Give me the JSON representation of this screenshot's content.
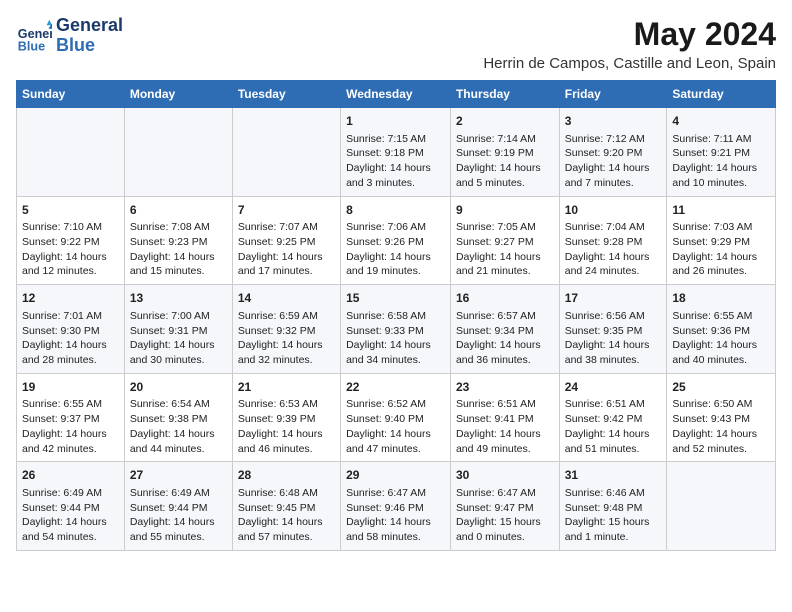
{
  "header": {
    "logo_line1": "General",
    "logo_line2": "Blue",
    "month": "May 2024",
    "location": "Herrin de Campos, Castille and Leon, Spain"
  },
  "weekdays": [
    "Sunday",
    "Monday",
    "Tuesday",
    "Wednesday",
    "Thursday",
    "Friday",
    "Saturday"
  ],
  "weeks": [
    [
      {
        "day": "",
        "content": ""
      },
      {
        "day": "",
        "content": ""
      },
      {
        "day": "",
        "content": ""
      },
      {
        "day": "1",
        "content": "Sunrise: 7:15 AM\nSunset: 9:18 PM\nDaylight: 14 hours and 3 minutes."
      },
      {
        "day": "2",
        "content": "Sunrise: 7:14 AM\nSunset: 9:19 PM\nDaylight: 14 hours and 5 minutes."
      },
      {
        "day": "3",
        "content": "Sunrise: 7:12 AM\nSunset: 9:20 PM\nDaylight: 14 hours and 7 minutes."
      },
      {
        "day": "4",
        "content": "Sunrise: 7:11 AM\nSunset: 9:21 PM\nDaylight: 14 hours and 10 minutes."
      }
    ],
    [
      {
        "day": "5",
        "content": "Sunrise: 7:10 AM\nSunset: 9:22 PM\nDaylight: 14 hours and 12 minutes."
      },
      {
        "day": "6",
        "content": "Sunrise: 7:08 AM\nSunset: 9:23 PM\nDaylight: 14 hours and 15 minutes."
      },
      {
        "day": "7",
        "content": "Sunrise: 7:07 AM\nSunset: 9:25 PM\nDaylight: 14 hours and 17 minutes."
      },
      {
        "day": "8",
        "content": "Sunrise: 7:06 AM\nSunset: 9:26 PM\nDaylight: 14 hours and 19 minutes."
      },
      {
        "day": "9",
        "content": "Sunrise: 7:05 AM\nSunset: 9:27 PM\nDaylight: 14 hours and 21 minutes."
      },
      {
        "day": "10",
        "content": "Sunrise: 7:04 AM\nSunset: 9:28 PM\nDaylight: 14 hours and 24 minutes."
      },
      {
        "day": "11",
        "content": "Sunrise: 7:03 AM\nSunset: 9:29 PM\nDaylight: 14 hours and 26 minutes."
      }
    ],
    [
      {
        "day": "12",
        "content": "Sunrise: 7:01 AM\nSunset: 9:30 PM\nDaylight: 14 hours and 28 minutes."
      },
      {
        "day": "13",
        "content": "Sunrise: 7:00 AM\nSunset: 9:31 PM\nDaylight: 14 hours and 30 minutes."
      },
      {
        "day": "14",
        "content": "Sunrise: 6:59 AM\nSunset: 9:32 PM\nDaylight: 14 hours and 32 minutes."
      },
      {
        "day": "15",
        "content": "Sunrise: 6:58 AM\nSunset: 9:33 PM\nDaylight: 14 hours and 34 minutes."
      },
      {
        "day": "16",
        "content": "Sunrise: 6:57 AM\nSunset: 9:34 PM\nDaylight: 14 hours and 36 minutes."
      },
      {
        "day": "17",
        "content": "Sunrise: 6:56 AM\nSunset: 9:35 PM\nDaylight: 14 hours and 38 minutes."
      },
      {
        "day": "18",
        "content": "Sunrise: 6:55 AM\nSunset: 9:36 PM\nDaylight: 14 hours and 40 minutes."
      }
    ],
    [
      {
        "day": "19",
        "content": "Sunrise: 6:55 AM\nSunset: 9:37 PM\nDaylight: 14 hours and 42 minutes."
      },
      {
        "day": "20",
        "content": "Sunrise: 6:54 AM\nSunset: 9:38 PM\nDaylight: 14 hours and 44 minutes."
      },
      {
        "day": "21",
        "content": "Sunrise: 6:53 AM\nSunset: 9:39 PM\nDaylight: 14 hours and 46 minutes."
      },
      {
        "day": "22",
        "content": "Sunrise: 6:52 AM\nSunset: 9:40 PM\nDaylight: 14 hours and 47 minutes."
      },
      {
        "day": "23",
        "content": "Sunrise: 6:51 AM\nSunset: 9:41 PM\nDaylight: 14 hours and 49 minutes."
      },
      {
        "day": "24",
        "content": "Sunrise: 6:51 AM\nSunset: 9:42 PM\nDaylight: 14 hours and 51 minutes."
      },
      {
        "day": "25",
        "content": "Sunrise: 6:50 AM\nSunset: 9:43 PM\nDaylight: 14 hours and 52 minutes."
      }
    ],
    [
      {
        "day": "26",
        "content": "Sunrise: 6:49 AM\nSunset: 9:44 PM\nDaylight: 14 hours and 54 minutes."
      },
      {
        "day": "27",
        "content": "Sunrise: 6:49 AM\nSunset: 9:44 PM\nDaylight: 14 hours and 55 minutes."
      },
      {
        "day": "28",
        "content": "Sunrise: 6:48 AM\nSunset: 9:45 PM\nDaylight: 14 hours and 57 minutes."
      },
      {
        "day": "29",
        "content": "Sunrise: 6:47 AM\nSunset: 9:46 PM\nDaylight: 14 hours and 58 minutes."
      },
      {
        "day": "30",
        "content": "Sunrise: 6:47 AM\nSunset: 9:47 PM\nDaylight: 15 hours and 0 minutes."
      },
      {
        "day": "31",
        "content": "Sunrise: 6:46 AM\nSunset: 9:48 PM\nDaylight: 15 hours and 1 minute."
      },
      {
        "day": "",
        "content": ""
      }
    ]
  ]
}
